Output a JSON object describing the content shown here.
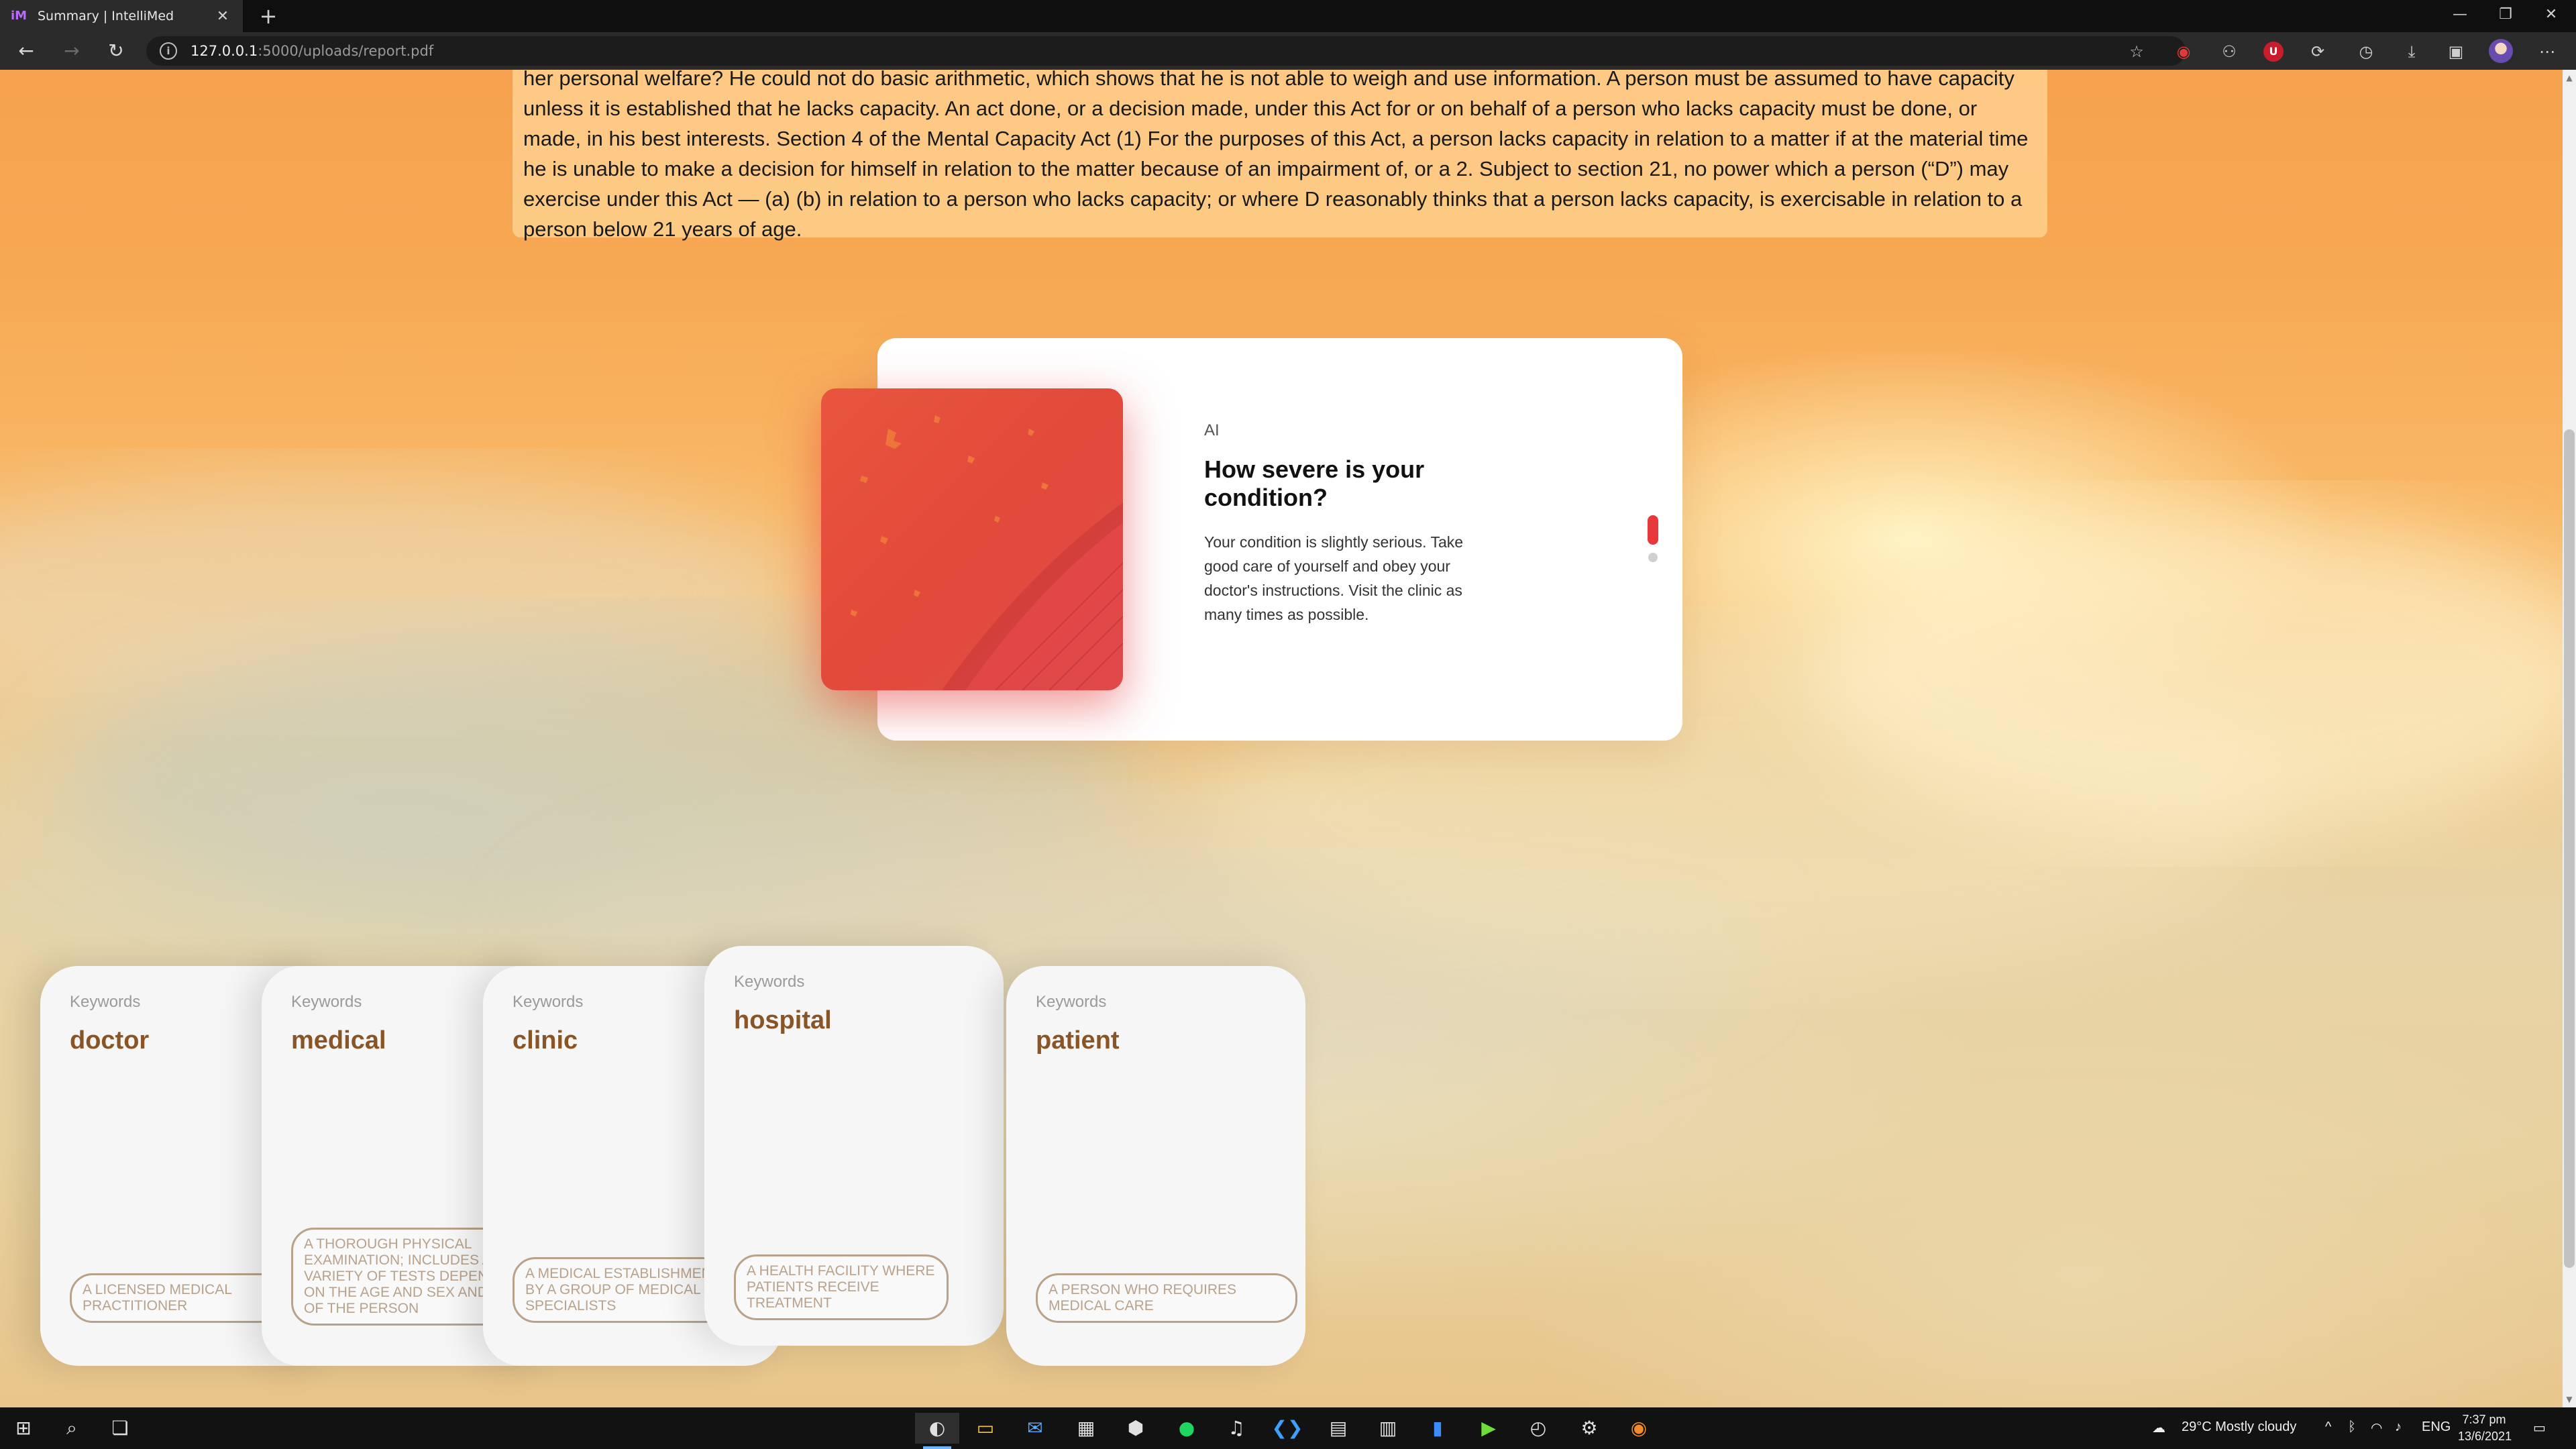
{
  "browser": {
    "tab_title": "Summary | IntelliMed",
    "favicon_text": "iM",
    "url_host": "127.0.0.1",
    "url_path": ":5000/uploads/report.pdf"
  },
  "summary": {
    "text": "her personal welfare? He could not do basic arithmetic, which shows that he is not able to weigh and use information. A person must be assumed to have capacity unless it is established that he lacks capacity. An act done, or a decision made, under this Act for or on behalf of a person who lacks capacity must be done, or made, in his best interests. Section 4 of the Mental Capacity Act (1) For the purposes of this Act, a person lacks capacity in relation to a matter if at the material time he is unable to make a decision for himself in relation to the matter because of an impairment of, or a 2. Subject to section 21, no power which a person (“D”) may exercise under this Act — (a) (b) in relation to a person who lacks capacity; or where D reasonably thinks that a person lacks capacity, is exercisable in relation to a person below 21 years of age."
  },
  "ai_card": {
    "label": "AI",
    "title": "How severe is your condition?",
    "body": "Your condition is slightly serious. Take good care of yourself and obey your doctor's instructions. Visit the clinic as many times as possible.",
    "accent": "#e8383b"
  },
  "keywords": [
    {
      "label": "Keywords",
      "word": "doctor",
      "definition": "A licensed medical practitioner"
    },
    {
      "label": "Keywords",
      "word": "medical",
      "definition": "A thorough physical examination; includes a variety of tests depending on the age and sex and health of the person"
    },
    {
      "label": "Keywords",
      "word": "clinic",
      "definition": "A medical establishment run by a group of medical specialists"
    },
    {
      "label": "Keywords",
      "word": "hospital",
      "definition": "A health facility where patients receive treatment"
    },
    {
      "label": "Keywords",
      "word": "patient",
      "definition": "A person who requires medical care"
    }
  ],
  "taskbar": {
    "weather": "29°C  Mostly cloudy",
    "language": "ENG",
    "time": "7:37 pm",
    "date": "13/6/2021"
  }
}
